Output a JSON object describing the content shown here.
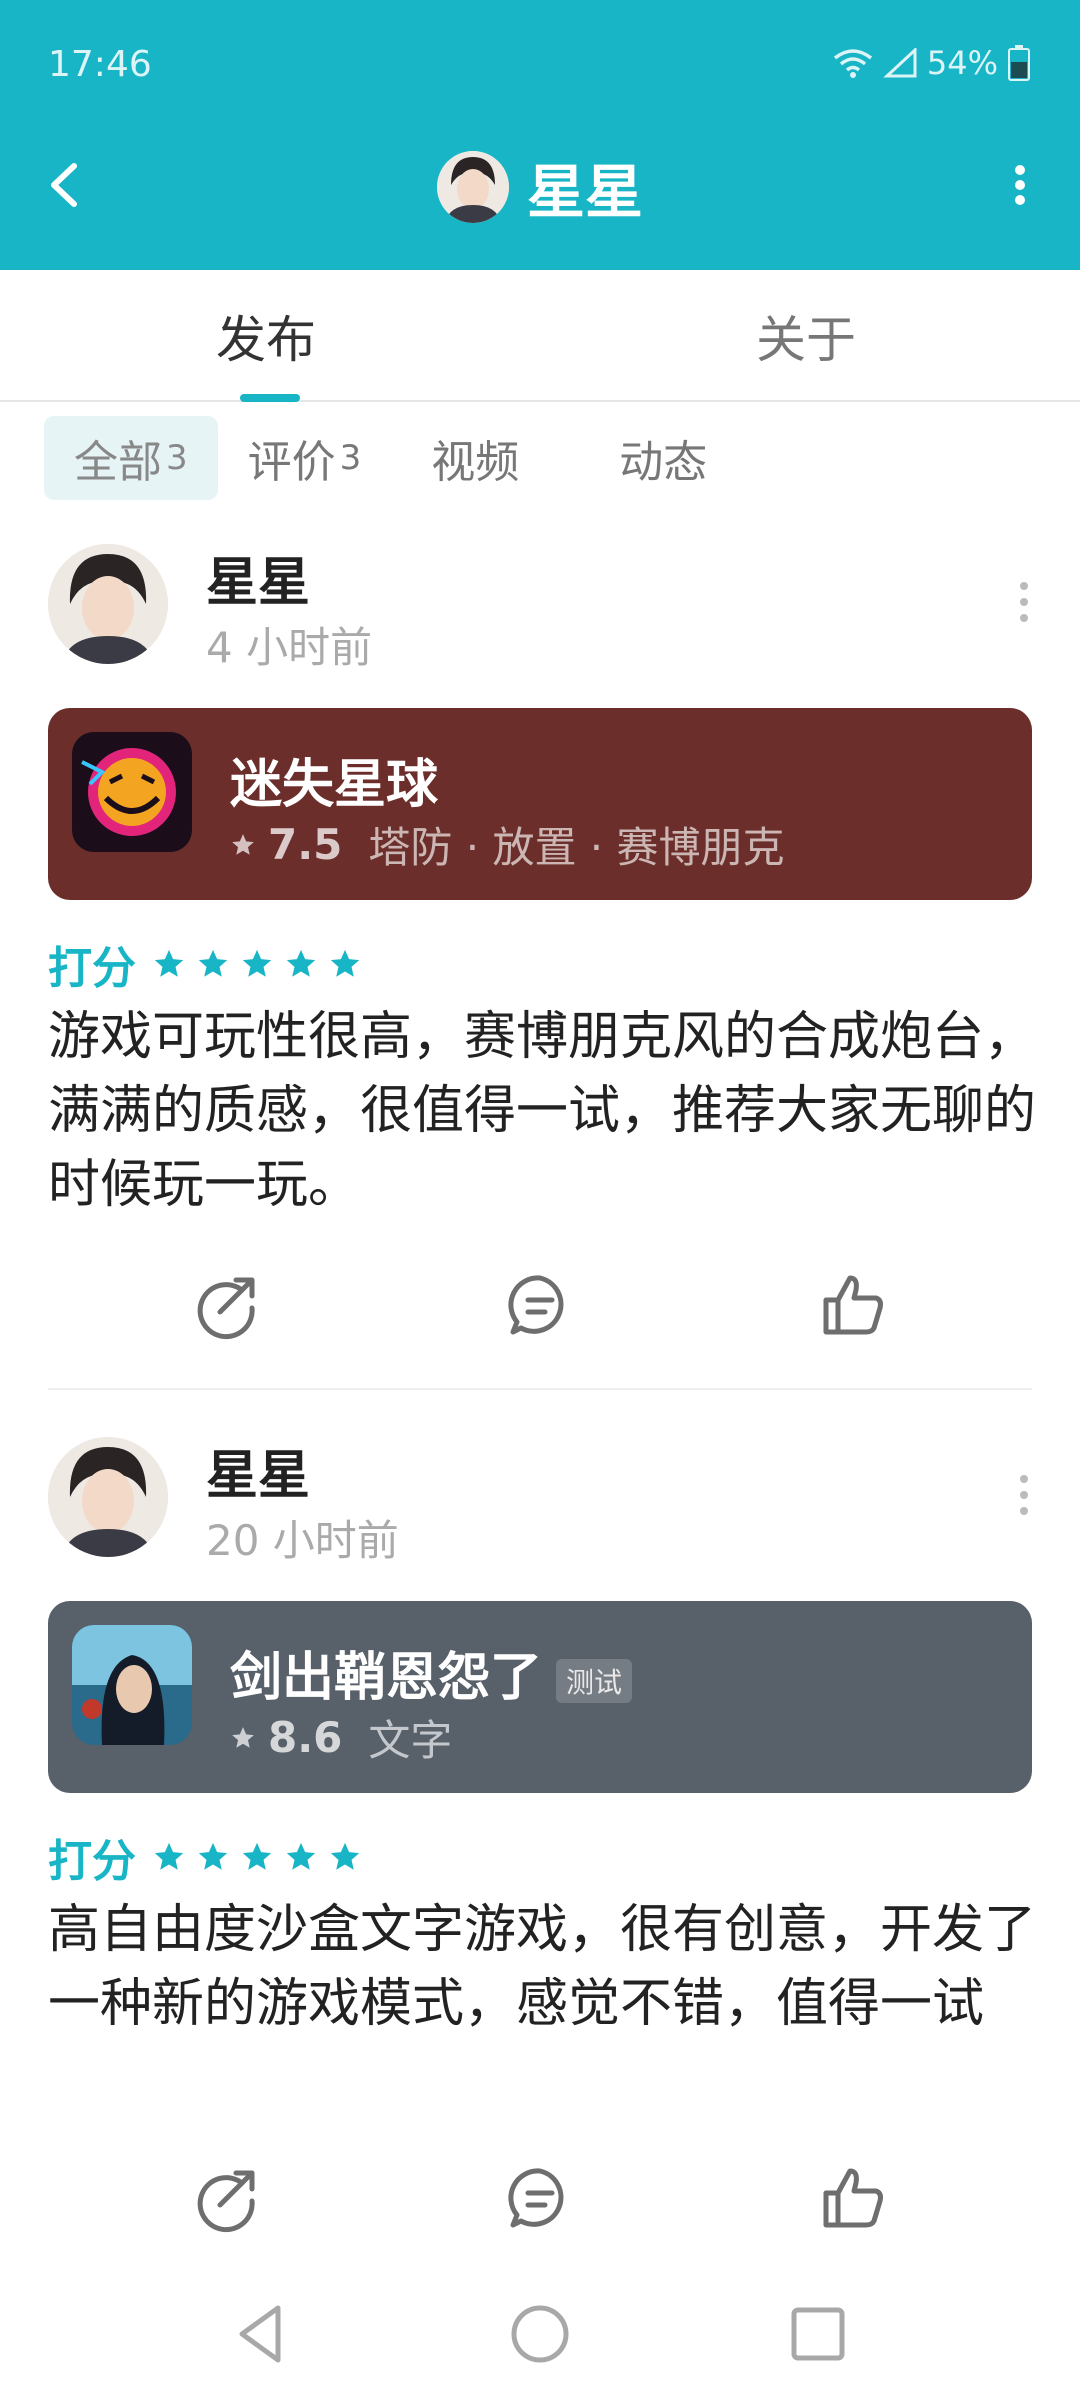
{
  "status": {
    "time": "17:46",
    "battery": "54%"
  },
  "header": {
    "title": "星星"
  },
  "tabs": [
    {
      "label": "发布"
    },
    {
      "label": "关于"
    }
  ],
  "filters": [
    {
      "label": "全部",
      "count": "3"
    },
    {
      "label": "评价",
      "count": "3"
    },
    {
      "label": "视频",
      "count": ""
    },
    {
      "label": "动态",
      "count": ""
    }
  ],
  "posts": [
    {
      "author": "星星",
      "time": "4 小时前",
      "game": {
        "name": "迷失星球",
        "score": "7.5",
        "tags": "塔防 · 放置 · 赛博朋克",
        "badge": ""
      },
      "rating_label": "打分",
      "review": "游戏可玩性很高，赛博朋克风的合成炮台，满满的质感，很值得一试，推荐大家无聊的时候玩一玩。"
    },
    {
      "author": "星星",
      "time": "20 小时前",
      "game": {
        "name": "剑出鞘恩怨了",
        "score": "8.6",
        "tags": "文字",
        "badge": "测试"
      },
      "rating_label": "打分",
      "review": "高自由度沙盒文字游戏，很有创意，开发了一种新的游戏模式，感觉不错，值得一试"
    }
  ],
  "colors": {
    "accent": "#17b5c5",
    "card1": "#6b2e2a",
    "card2": "#58606a"
  },
  "icons": [
    "back-icon",
    "more-icon",
    "share-icon",
    "comment-icon",
    "like-icon",
    "star-icon",
    "nav-back-icon",
    "nav-home-icon",
    "nav-recents-icon"
  ]
}
